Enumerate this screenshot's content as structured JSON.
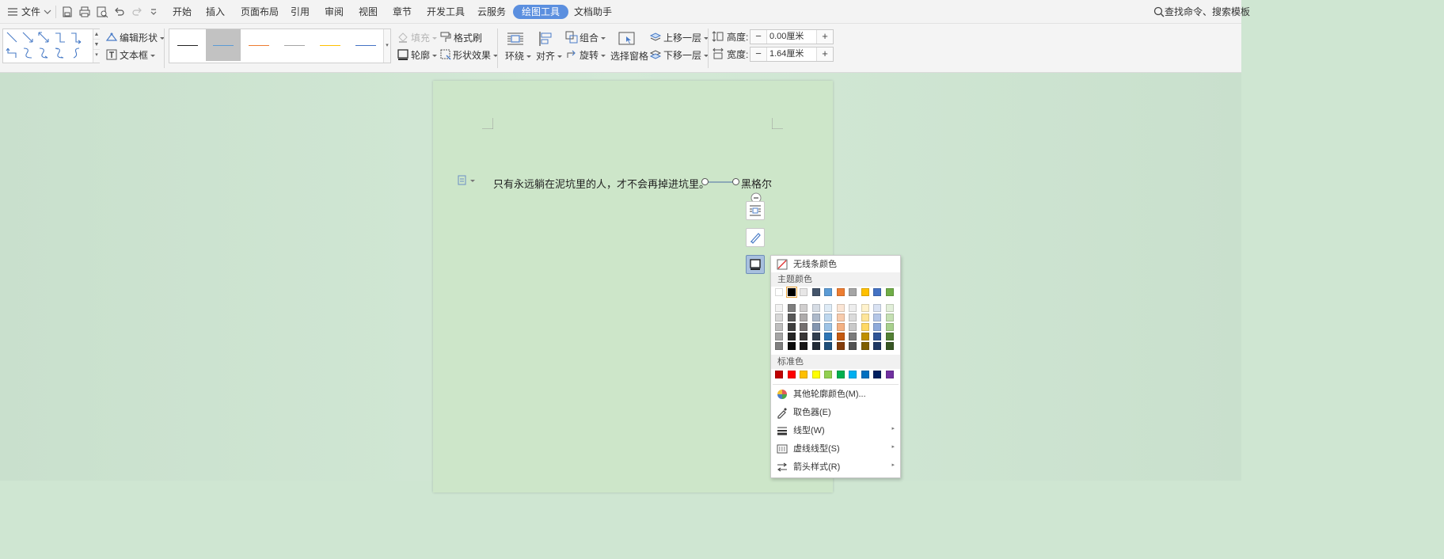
{
  "menubar": {
    "file": "文件",
    "tabs": [
      "开始",
      "插入",
      "页面布局",
      "引用",
      "审阅",
      "视图",
      "章节",
      "开发工具",
      "云服务"
    ],
    "active_tab": "绘图工具",
    "assistant_tab": "文档助手",
    "search": "查找命令、搜索模板"
  },
  "ribbon": {
    "edit_shape": "编辑形状",
    "text_box": "文本框",
    "fill": "填充",
    "format_painter": "格式刷",
    "outline": "轮廓",
    "shape_effects": "形状效果",
    "wrap": "环绕",
    "align": "对齐",
    "group": "组合",
    "rotate": "旋转",
    "selection_pane": "选择窗格",
    "bring_forward": "上移一层",
    "send_backward": "下移一层",
    "height_label": "高度:",
    "height_value": "0.00厘米",
    "width_label": "宽度:",
    "width_value": "1.64厘米",
    "line_style_colors": [
      "#222222",
      "#5b9bd5",
      "#ed7d31",
      "#a5a5a5",
      "#ffc000",
      "#4472c4"
    ]
  },
  "document": {
    "quote": "只有永远躺在泥坑里的人，才不会再掉进坑里。",
    "author": "黑格尔"
  },
  "dropdown": {
    "no_line_color": "无线条颜色",
    "theme_colors_title": "主题颜色",
    "theme_top": [
      "#ffffff",
      "#000000",
      "#e7e6e6",
      "#44546a",
      "#5b9bd5",
      "#ed7d31",
      "#a5a5a5",
      "#ffc000",
      "#4472c4",
      "#70ad47"
    ],
    "theme_shades": [
      [
        "#f2f2f2",
        "#7f7f7f",
        "#d0cece",
        "#d6dce4",
        "#deebf6",
        "#fbe5d5",
        "#ededed",
        "#fff2cc",
        "#d9e2f3",
        "#e2efd9"
      ],
      [
        "#d8d8d8",
        "#595959",
        "#aeabab",
        "#adb9ca",
        "#bdd7ee",
        "#f7cbac",
        "#dbdbdb",
        "#fee599",
        "#b4c6e7",
        "#c5e0b3"
      ],
      [
        "#bfbfbf",
        "#3f3f3f",
        "#757070",
        "#8496b0",
        "#9dc3e6",
        "#f4b183",
        "#c9c9c9",
        "#ffd965",
        "#8eaadb",
        "#a8d08d"
      ],
      [
        "#a5a5a5",
        "#262626",
        "#3a3838",
        "#323f4f",
        "#2e75b5",
        "#c55a11",
        "#7b7b7b",
        "#bf9000",
        "#2f5496",
        "#538135"
      ],
      [
        "#7f7f7f",
        "#0c0c0c",
        "#171616",
        "#222a35",
        "#1e4e79",
        "#833c0b",
        "#525252",
        "#7f6000",
        "#1f3864",
        "#375623"
      ]
    ],
    "standard_title": "标准色",
    "standard_colors": [
      "#c00000",
      "#ff0000",
      "#ffc000",
      "#ffff00",
      "#92d050",
      "#00b050",
      "#00b0f0",
      "#0070c0",
      "#002060",
      "#7030a0"
    ],
    "more_colors": "其他轮廓颜色(M)...",
    "eyedropper": "取色器(E)",
    "line_type": "线型(W)",
    "dash_type": "虚线线型(S)",
    "arrow_style": "箭头样式(R)"
  }
}
